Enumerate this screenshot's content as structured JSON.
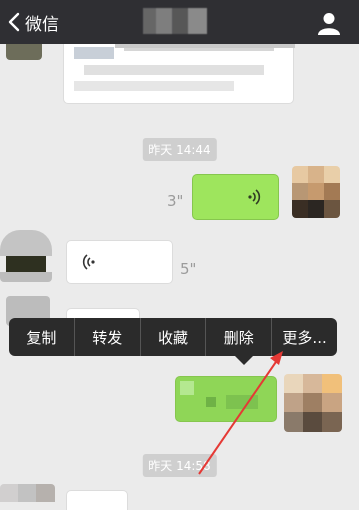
{
  "topbar": {
    "back_label": "微信",
    "back_icon": "chevron-left-icon",
    "profile_icon": "person-icon"
  },
  "chat": {
    "timestamps": [
      "昨天 14:44",
      "昨天 14:58"
    ],
    "voice_out_duration": "3\"",
    "voice_in_duration": "5\""
  },
  "context_menu": {
    "items": [
      "复制",
      "转发",
      "收藏",
      "删除",
      "更多..."
    ]
  },
  "annotation": {
    "arrow_color": "#e53935"
  }
}
